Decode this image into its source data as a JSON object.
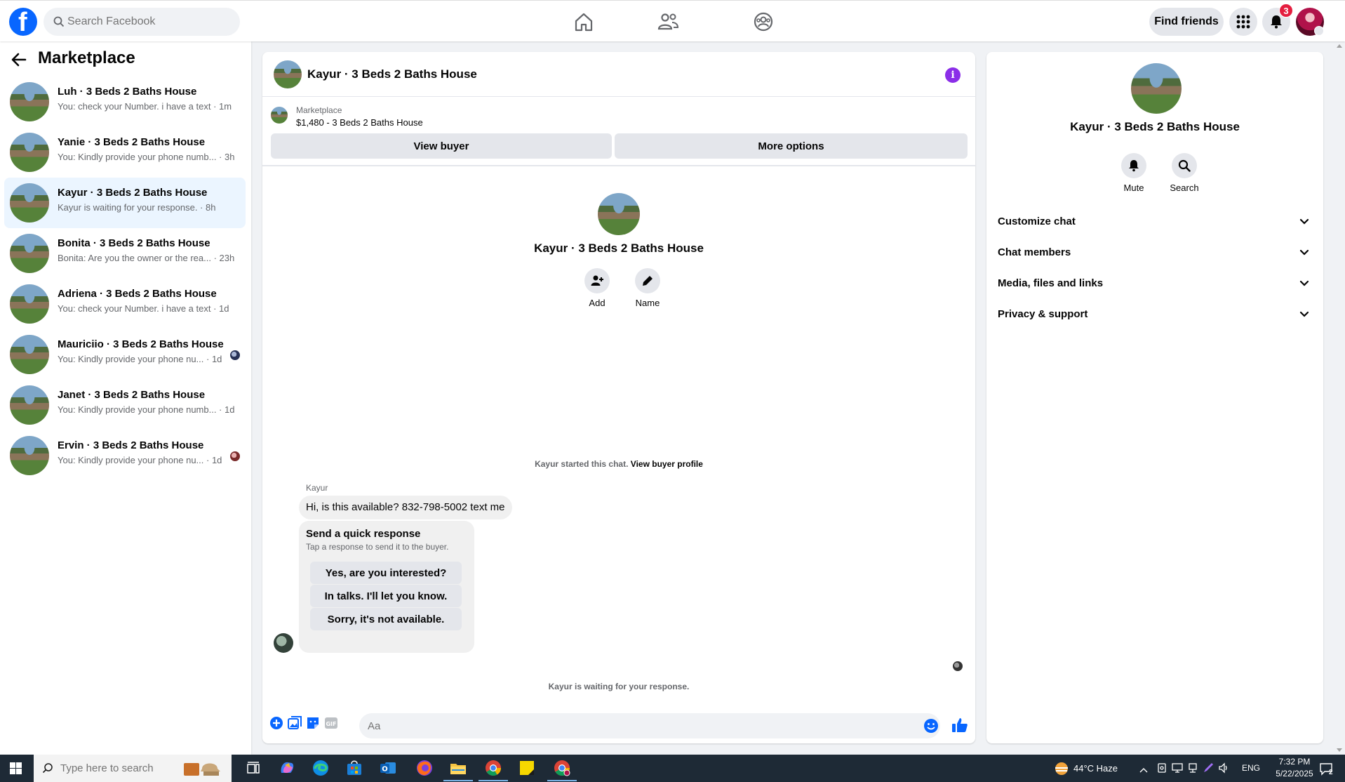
{
  "topbar": {
    "search_placeholder": "Search Facebook",
    "find_friends_label": "Find friends",
    "notifications_count": "3",
    "brand_color": "#0866ff"
  },
  "sidebar": {
    "title": "Marketplace",
    "conversations": [
      {
        "name": "Luh · 3 Beds 2 Baths House",
        "preview": "You: check your Number. i have a text · 1m",
        "active": false
      },
      {
        "name": "Yanie · 3 Beds 2 Baths House",
        "preview": "You: Kindly provide your phone numb... · 3h",
        "active": false
      },
      {
        "name": "Kayur · 3 Beds 2 Baths House",
        "preview": "Kayur is waiting for your response. · 8h",
        "active": true
      },
      {
        "name": "Bonita · 3 Beds 2 Baths House",
        "preview": "Bonita: Are you the owner or the rea... · 23h",
        "active": false
      },
      {
        "name": "Adriena · 3 Beds 2 Baths House",
        "preview": "You: check your Number. i have a text · 1d",
        "active": false
      },
      {
        "name": "Mauriciio · 3 Beds 2 Baths House",
        "preview": "You: Kindly provide your phone nu... · 1d",
        "active": false
      },
      {
        "name": "Janet · 3 Beds 2 Baths House",
        "preview": "You: Kindly provide your phone numb... · 1d",
        "active": false
      },
      {
        "name": "Ervin · 3 Beds 2 Baths House",
        "preview": "You: Kindly provide your phone nu... · 1d",
        "active": false
      }
    ]
  },
  "chat": {
    "title": "Kayur · 3 Beds 2 Baths House",
    "info_icon": "info-icon",
    "listing_source": "Marketplace",
    "listing_price": "$1,480 - 3 Beds 2 Baths House",
    "view_buyer_label": "View buyer",
    "more_options_label": "More options",
    "profile_name": "Kayur · 3 Beds 2 Baths House",
    "add_label": "Add",
    "name_label": "Name",
    "started_text": "Kayur started this chat.",
    "view_buyer_profile_label": "View buyer profile",
    "sender_name": "Kayur",
    "message_text": "Hi, is this available?  832-798-5002 text me",
    "quick_title": "Send a quick response",
    "quick_subtitle": "Tap a response to send it to the buyer.",
    "quick_responses": [
      "Yes, are you interested?",
      "In talks. I'll let you know.",
      "Sorry, it's not available."
    ],
    "waiting_text": "Kayur is waiting for your response.",
    "input_placeholder": "Aa"
  },
  "right_panel": {
    "name": "Kayur · 3 Beds 2 Baths House",
    "mute_label": "Mute",
    "search_label": "Search",
    "sections": [
      "Customize chat",
      "Chat members",
      "Media, files and links",
      "Privacy & support"
    ]
  },
  "taskbar": {
    "search_placeholder": "Type here to search",
    "weather": "44°C  Haze",
    "language": "ENG",
    "time": "7:32 PM",
    "date": "5/22/2025",
    "notif_count": "2"
  }
}
